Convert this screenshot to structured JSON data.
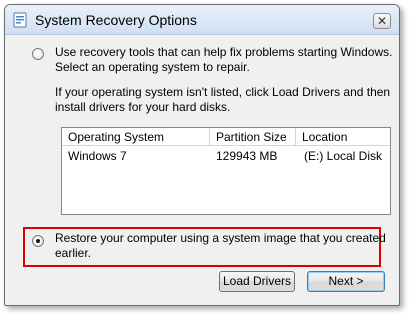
{
  "window": {
    "title": "System Recovery Options",
    "close_glyph": "✕"
  },
  "option_tools": {
    "selected": false,
    "line1": "Use recovery tools that can help fix problems starting Windows.",
    "line2": "Select an operating system to repair.",
    "note_line1": "If your operating system isn't listed, click Load Drivers and then",
    "note_line2": "install drivers for your hard disks."
  },
  "os_table": {
    "columns": [
      "Operating System",
      "Partition Size",
      "Location"
    ],
    "rows": [
      {
        "os": "Windows 7",
        "size": "129943 MB",
        "location": "(E:) Local Disk"
      }
    ]
  },
  "option_image": {
    "selected": true,
    "line1": "Restore your computer using a system image that you created",
    "line2": "earlier."
  },
  "buttons": {
    "load_drivers": "Load Drivers",
    "next": "Next >"
  },
  "colors": {
    "highlight_border": "#e00000",
    "titlebar": "#dbe7f5"
  }
}
